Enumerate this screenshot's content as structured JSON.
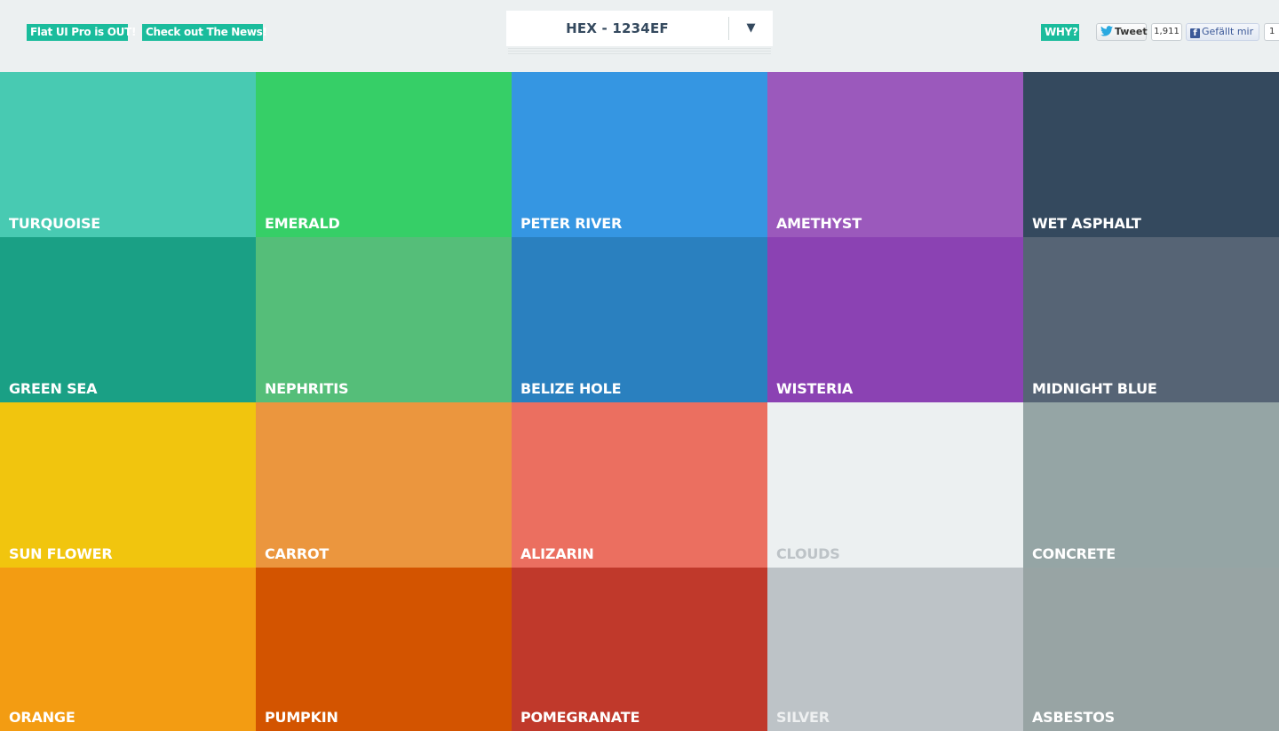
{
  "header": {
    "promo_pro": "Flat UI Pro is OUT!",
    "promo_news": "Check out The News!",
    "format_select": {
      "value": "HEX - 1234EF",
      "caret": "▼"
    },
    "why_label": "WHY?",
    "tweet_label": "Tweet",
    "tweet_count": "1,911",
    "facebook_label": "Gefällt mir",
    "facebook_count": "1"
  },
  "colors": {
    "accent": "#1abc9c",
    "background": "#ecf0f1",
    "text_dark": "#34495e"
  },
  "swatches": [
    {
      "name": "TURQUOISE",
      "hex": "#48cab2"
    },
    {
      "name": "EMERALD",
      "hex": "#36cf67"
    },
    {
      "name": "PETER RIVER",
      "hex": "#3596e2"
    },
    {
      "name": "AMETHYST",
      "hex": "#9b59bc"
    },
    {
      "name": "WET ASPHALT",
      "hex": "#34495e"
    },
    {
      "name": "GREEN SEA",
      "hex": "#1aa085"
    },
    {
      "name": "NEPHRITIS",
      "hex": "#55be79"
    },
    {
      "name": "BELIZE HOLE",
      "hex": "#2a80bf"
    },
    {
      "name": "WISTERIA",
      "hex": "#8b42b3"
    },
    {
      "name": "MIDNIGHT BLUE",
      "hex": "#566475"
    },
    {
      "name": "SUN FLOWER",
      "hex": "#f1c50e"
    },
    {
      "name": "CARROT",
      "hex": "#eb963e"
    },
    {
      "name": "ALIZARIN",
      "hex": "#eb6f60"
    },
    {
      "name": "CLOUDS",
      "hex": "#ecf0f1"
    },
    {
      "name": "CONCRETE",
      "hex": "#95a5a5"
    },
    {
      "name": "ORANGE",
      "hex": "#f39c12"
    },
    {
      "name": "PUMPKIN",
      "hex": "#d35400"
    },
    {
      "name": "POMEGRANATE",
      "hex": "#c0392b"
    },
    {
      "name": "SILVER",
      "hex": "#bdc3c7"
    },
    {
      "name": "ASBESTOS",
      "hex": "#98a4a4"
    }
  ]
}
